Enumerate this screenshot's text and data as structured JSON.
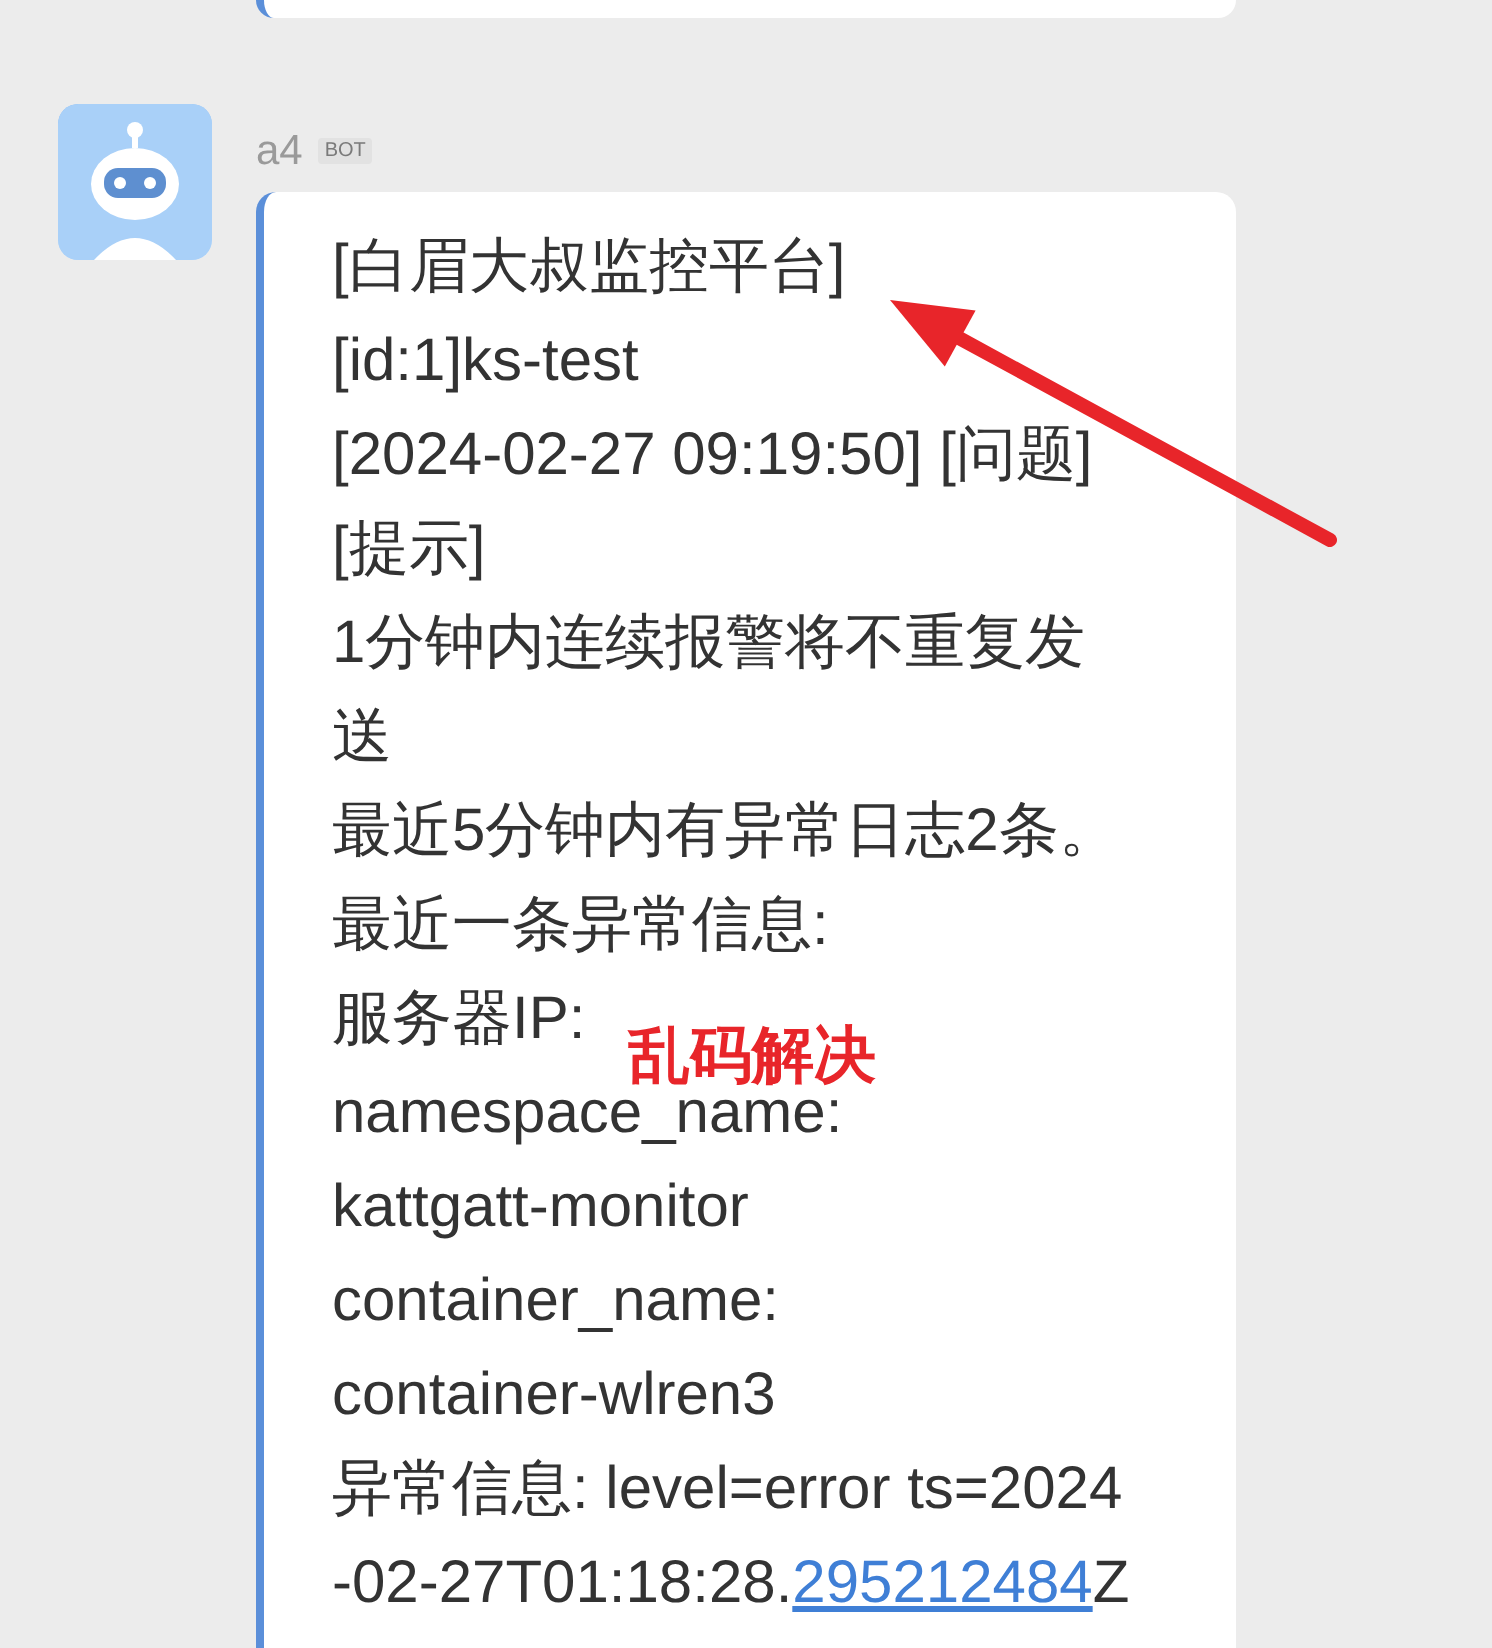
{
  "sender": {
    "name": "a4",
    "badge": "BOT"
  },
  "message": {
    "lines": [
      {
        "kind": "text",
        "text": "[白眉大叔监控平台]"
      },
      {
        "kind": "text",
        "text": "[id:1]ks-test"
      },
      {
        "kind": "text",
        "text": "[2024-02-27 09:19:50] [问题]"
      },
      {
        "kind": "text",
        "text": "[提示]"
      },
      {
        "kind": "text",
        "text": "1分钟内连续报警将不重复发"
      },
      {
        "kind": "text",
        "text": "送"
      },
      {
        "kind": "text",
        "text": "最近5分钟内有异常日志2条。"
      },
      {
        "kind": "text",
        "text": "最近一条异常信息:"
      },
      {
        "kind": "text",
        "text": "服务器IP:"
      },
      {
        "kind": "text",
        "text": "namespace_name:"
      },
      {
        "kind": "text",
        "text": "kattgatt-monitor"
      },
      {
        "kind": "text",
        "text": "container_name:"
      },
      {
        "kind": "text",
        "text": "container-wlren3"
      },
      {
        "kind": "text",
        "text": "异常信息: level=error ts=2024"
      },
      {
        "kind": "mixed",
        "segments": [
          {
            "text": "-02-27T01:18:28.",
            "link": false
          },
          {
            "text": "295212484",
            "link": true
          },
          {
            "text": "Z",
            "link": false
          }
        ]
      }
    ]
  },
  "annotation": {
    "text": "乱码解决"
  }
}
